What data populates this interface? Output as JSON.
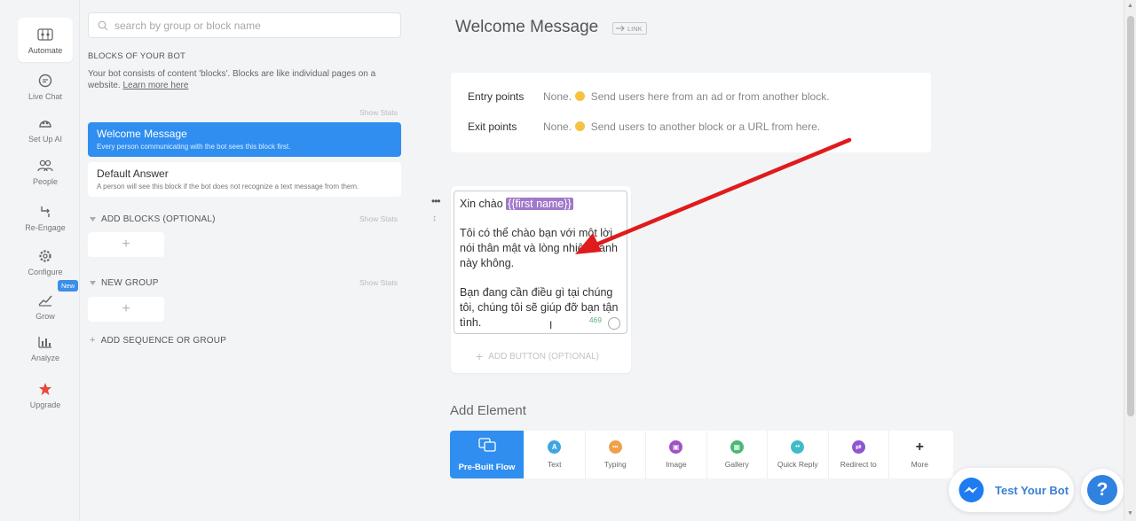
{
  "nav": {
    "items": [
      {
        "label": "Automate",
        "icon": "automate-icon"
      },
      {
        "label": "Live Chat",
        "icon": "chat-icon"
      },
      {
        "label": "Set Up AI",
        "icon": "ai-icon"
      },
      {
        "label": "People",
        "icon": "people-icon"
      },
      {
        "label": "Re-Engage",
        "icon": "reengage-icon"
      },
      {
        "label": "Configure",
        "icon": "gear-icon"
      },
      {
        "label": "Grow",
        "icon": "grow-icon"
      },
      {
        "label": "Analyze",
        "icon": "chart-icon"
      },
      {
        "label": "Upgrade",
        "icon": "star-icon"
      }
    ],
    "new_badge": "New"
  },
  "blocks_panel": {
    "search_placeholder": "search by group or block name",
    "section_title": "BLOCKS OF YOUR BOT",
    "description": "Your bot consists of content 'blocks'. Blocks are like individual pages on a website.",
    "learn_more": "Learn more here",
    "show_stats": "Show Stats",
    "blocks": [
      {
        "title": "Welcome Message",
        "subtitle": "Every person communicating with the bot sees this block first."
      },
      {
        "title": "Default Answer",
        "subtitle": "A person will see this block if the bot does not recognize a text message from them."
      }
    ],
    "groups": [
      {
        "label": "ADD BLOCKS (OPTIONAL)"
      },
      {
        "label": "NEW GROUP"
      }
    ],
    "add_sequence": "ADD SEQUENCE OR GROUP",
    "plus": "+"
  },
  "main": {
    "title": "Welcome Message",
    "link_label": "LINK",
    "entry_label": "Entry points",
    "entry_none": "None.",
    "entry_text": "Send users here from an ad or from another block.",
    "exit_label": "Exit points",
    "exit_none": "None.",
    "exit_text": "Send users to another block or a URL from here.",
    "message": {
      "greeting": "Xin chào",
      "tag": "{{first name}}",
      "line1": "Tôi có thể chào bạn với một lời nói thân mật và lòng nhiệt thành này không.",
      "line2": "Bạn đang cần điều gì tại chúng tôi, chúng tôi sẽ giúp đỡ bạn tận tình.",
      "counter": "469"
    },
    "add_button": "ADD BUTTON (OPTIONAL)",
    "add_element_title": "Add Element",
    "elements": [
      {
        "label": "Pre-Built Flow",
        "icon": "prebuilt-flow-icon",
        "glyph": "",
        "color": "#ffffff"
      },
      {
        "label": "Text",
        "icon": "text-icon",
        "glyph": "A",
        "color": "#3fa5e0"
      },
      {
        "label": "Typing",
        "icon": "typing-icon",
        "glyph": "•••",
        "color": "#f0a04a"
      },
      {
        "label": "Image",
        "icon": "image-icon",
        "glyph": "▣",
        "color": "#9e52c7"
      },
      {
        "label": "Gallery",
        "icon": "gallery-icon",
        "glyph": "▦",
        "color": "#4bb774"
      },
      {
        "label": "Quick Reply",
        "icon": "quick-reply-icon",
        "glyph": "••",
        "color": "#3fbcc9"
      },
      {
        "label": "Redirect to",
        "icon": "redirect-icon",
        "glyph": "⇄",
        "color": "#8e57d0"
      },
      {
        "label": "More",
        "icon": "plus-icon",
        "glyph": "+",
        "color": "#333333"
      }
    ]
  },
  "test_bot": "Test Your Bot",
  "help": "?"
}
